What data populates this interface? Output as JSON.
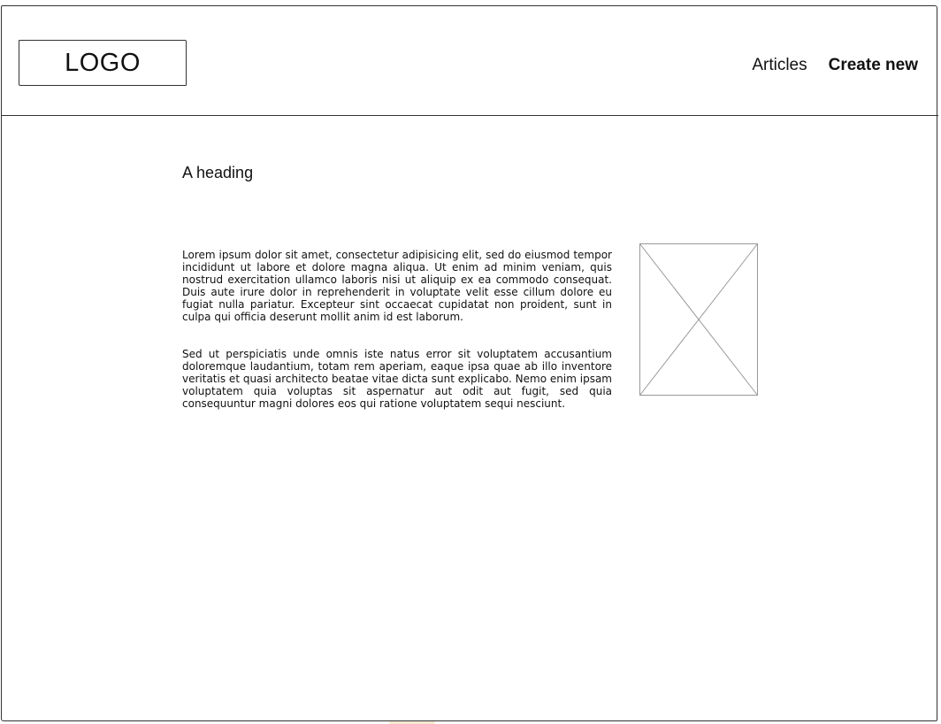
{
  "header": {
    "logo_text": "LOGO",
    "nav": [
      {
        "label": "Articles",
        "bold": false
      },
      {
        "label": "Create new",
        "bold": true
      }
    ]
  },
  "main": {
    "heading": "A heading",
    "paragraphs": [
      "Lorem ipsum dolor sit amet, consectetur adipisicing elit, sed do eiusmod tempor incididunt ut labore et dolore magna aliqua. Ut enim ad minim veniam, quis nostrud exercitation ullamco laboris nisi ut aliquip ex ea commodo consequat. Duis aute irure dolor in reprehenderit in voluptate velit esse cillum dolore eu fugiat nulla pariatur. Excepteur sint occaecat cupidatat non proident, sunt in culpa qui officia deserunt mollit anim id est laborum.",
      "Sed ut perspiciatis unde omnis iste natus error sit voluptatem accusantium doloremque laudantium, totam rem aperiam, eaque ipsa quae ab illo inventore veritatis et quasi architecto beatae vitae dicta sunt explicabo. Nemo enim ipsam voluptatem quia voluptas sit aspernatur aut odit aut fugit, sed quia consequuntur magni dolores eos qui ratione voluptatem sequi nesciunt."
    ],
    "image_icon": "image-placeholder-icon"
  },
  "colors": {
    "stroke": "#333333",
    "placeholder_stroke": "#999999",
    "text": "#111111",
    "background": "#ffffff"
  }
}
